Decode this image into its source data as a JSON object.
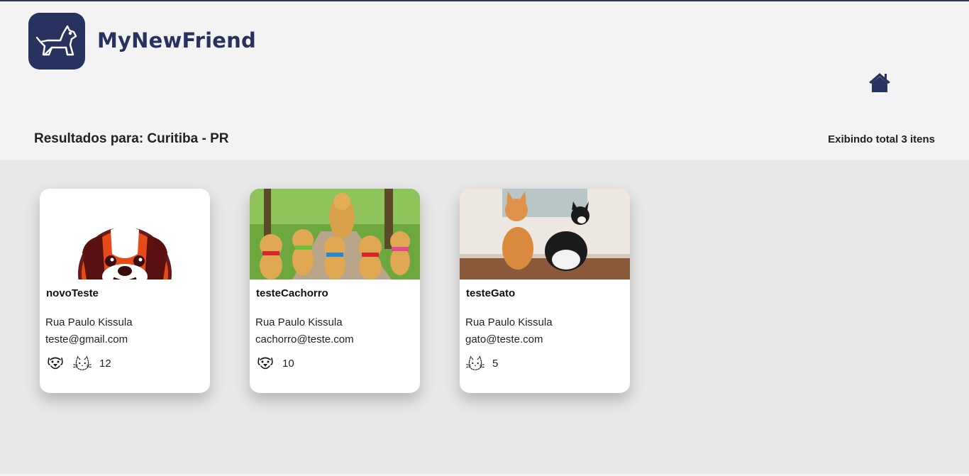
{
  "header": {
    "brand": "MyNewFriend",
    "logo_icon": "dog-logo-icon",
    "home_icon": "home-icon",
    "brand_color": "#27325f"
  },
  "results": {
    "title": "Resultados para: Curitiba - PR",
    "count": "Exibindo total 3 itens"
  },
  "cards": [
    {
      "name": "novoTeste",
      "address": "Rua Paulo Kissula",
      "email": "teste@gmail.com",
      "image": "beagle-logo-illustration",
      "pet_icons": [
        "dog-face-icon",
        "cat-face-icon"
      ],
      "count": "12"
    },
    {
      "name": "testeCachorro",
      "address": "Rua Paulo Kissula",
      "email": "cachorro@teste.com",
      "image": "golden-retriever-puppies-photo",
      "pet_icons": [
        "dog-face-icon"
      ],
      "count": "10"
    },
    {
      "name": "testeGato",
      "address": "Rua Paulo Kissula",
      "email": "gato@teste.com",
      "image": "two-cats-photo",
      "pet_icons": [
        "cat-face-icon"
      ],
      "count": "5"
    }
  ]
}
